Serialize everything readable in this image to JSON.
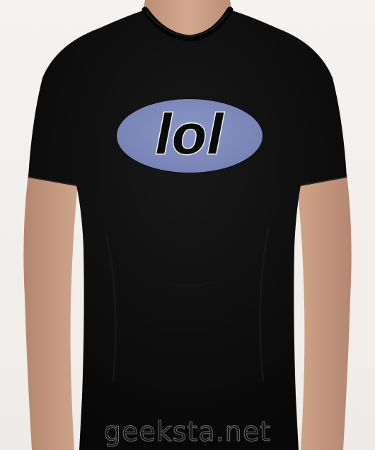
{
  "product": {
    "print_text": "lol",
    "print_colors": {
      "oval": "#7b87b8",
      "text": "#0a0a0a",
      "outline": "#f2f2f2"
    },
    "shirt_color": "#0d0d0d",
    "skin_color": "#c99f86"
  },
  "watermark": {
    "text": "geeksta.net"
  }
}
